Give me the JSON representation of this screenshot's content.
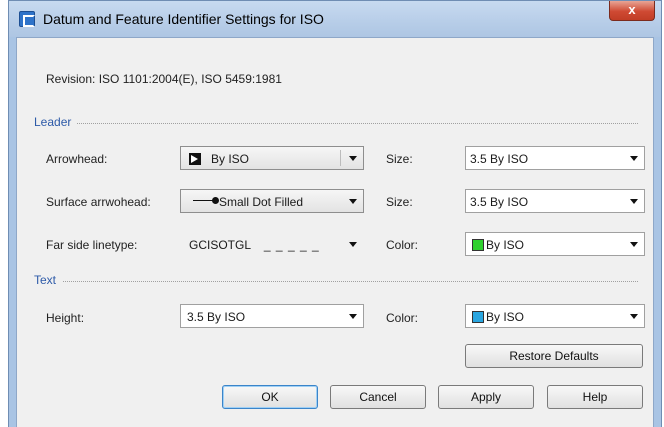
{
  "dialog": {
    "title": "Datum and Feature Identifier Settings for ISO",
    "close_label": "x",
    "revision": "Revision: ISO 1101:2004(E), ISO 5459:1981"
  },
  "leader": {
    "section_label": "Leader",
    "arrowhead": {
      "label": "Arrowhead:",
      "value": "By ISO",
      "icon": "filled-arrowhead-icon"
    },
    "arrowhead_size": {
      "label": "Size:",
      "value": "3.5 By ISO"
    },
    "surface_arrowhead": {
      "label": "Surface arrwohead:",
      "value": "Small Dot Filled",
      "icon": "small-dot-filled-icon"
    },
    "surface_size": {
      "label": "Size:",
      "value": "3.5 By ISO"
    },
    "far_side_linetype": {
      "label": "Far side linetype:",
      "value": "GCISOTGL",
      "pattern": "_ _ _ _ _"
    },
    "color": {
      "label": "Color:",
      "value": "By ISO",
      "swatch": "#2fd12f"
    }
  },
  "text": {
    "section_label": "Text",
    "height": {
      "label": "Height:",
      "value": "3.5 By ISO"
    },
    "color": {
      "label": "Color:",
      "value": "By ISO",
      "swatch": "#2aa6e0"
    }
  },
  "buttons": {
    "restore_defaults": "Restore Defaults",
    "ok": "OK",
    "cancel": "Cancel",
    "apply": "Apply",
    "help": "Help"
  },
  "colors": {
    "section_header": "#2d5aa8",
    "title_bar": "#b7cde8",
    "close_button": "#cf4a33"
  }
}
